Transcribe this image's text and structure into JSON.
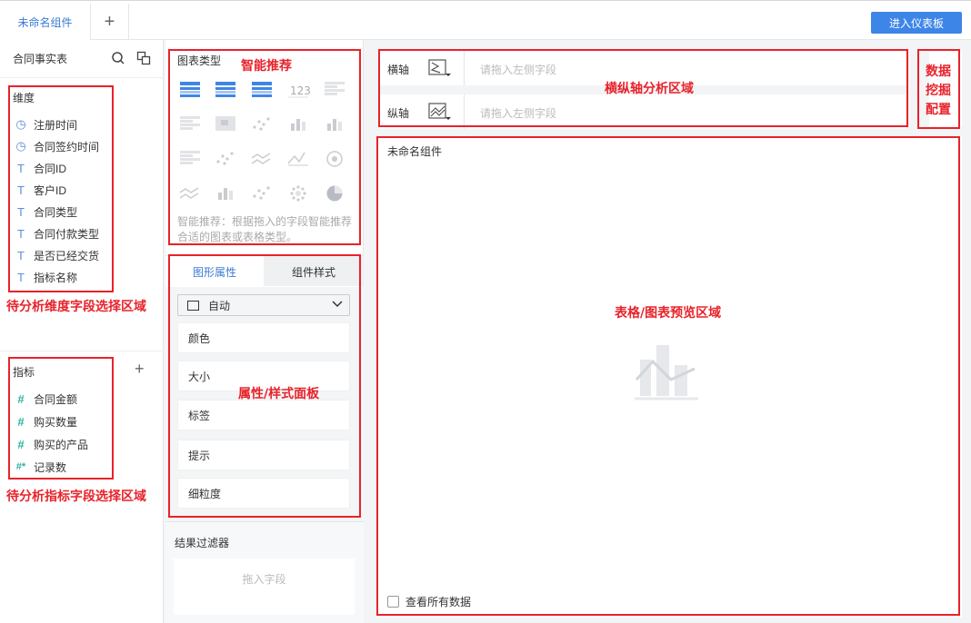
{
  "tabs": {
    "active": "未命名组件",
    "add": "+"
  },
  "topbar": {
    "enter_dashboard": "进入仪表板"
  },
  "left_panel": {
    "table_name": "合同事实表",
    "dimensions_title": "维度",
    "dimensions": [
      {
        "icon": "clock-icon",
        "label": "注册时间"
      },
      {
        "icon": "clock-icon",
        "label": "合同签约时间"
      },
      {
        "icon": "text-type-icon",
        "label": "合同ID"
      },
      {
        "icon": "text-type-icon",
        "label": "客户ID"
      },
      {
        "icon": "text-type-icon",
        "label": "合同类型"
      },
      {
        "icon": "text-type-icon",
        "label": "合同付款类型"
      },
      {
        "icon": "text-type-icon",
        "label": "是否已经交货"
      },
      {
        "icon": "text-type-icon",
        "label": "指标名称"
      }
    ],
    "metrics_title": "指标",
    "metrics": [
      {
        "icon": "number-type-icon",
        "label": "合同金额"
      },
      {
        "icon": "number-type-icon",
        "label": "购买数量"
      },
      {
        "icon": "number-type-icon",
        "label": "购买的产品"
      },
      {
        "icon": "record-count-icon",
        "label": "记录数"
      }
    ]
  },
  "chart_types": {
    "title": "图表类型",
    "hint": "智能推荐：根据拖入的字段智能推荐合适的图表或表格类型。"
  },
  "property_tabs": {
    "graphic": "图形属性",
    "component_style": "组件样式"
  },
  "chart_select": {
    "value": "自动"
  },
  "properties": [
    "颜色",
    "大小",
    "标签",
    "提示",
    "细粒度"
  ],
  "filter": {
    "title": "结果过滤器",
    "placeholder": "拖入字段"
  },
  "axes": {
    "x_label": "横轴",
    "y_label": "纵轴",
    "placeholder": "请拖入左侧字段"
  },
  "preview": {
    "title": "未命名组件",
    "view_all": "查看所有数据"
  },
  "annotations": {
    "smart_recommend": "智能推荐",
    "axis_area": "横纵轴分析区域",
    "mining": "数据挖掘配置",
    "preview_area": "表格/图表预览区域",
    "property_panel": "属性/样式面板",
    "dimension_area": "待分析维度字段选择区域",
    "metric_area": "待分析指标字段选择区域"
  },
  "colors": {
    "accent": "#3e85e8",
    "annotation_red": "#e8222a",
    "number_green": "#2bb3a3"
  }
}
